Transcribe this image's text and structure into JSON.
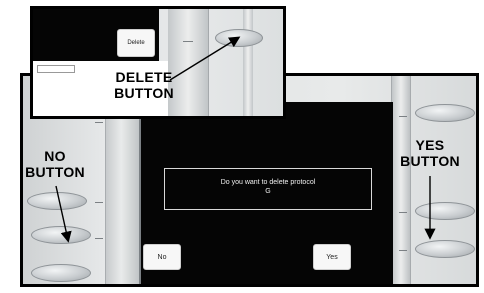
{
  "dialog": {
    "message_line1": "Do you want to delete protocol",
    "message_line2": "G"
  },
  "softkeys": {
    "no_label": "No",
    "yes_label": "Yes",
    "delete_label": "Delete"
  },
  "callouts": {
    "no_line1": "NO",
    "no_line2": "BUTTON",
    "yes_line1": "YES",
    "yes_line2": "BUTTON",
    "delete_line1": "DELETE",
    "delete_line2": "BUTTON"
  },
  "icons": {
    "arrow": "arrow-icon"
  },
  "colors": {
    "screen": "#050505",
    "panel": "#e6e8e9",
    "softkey": "#f7f7f7"
  }
}
